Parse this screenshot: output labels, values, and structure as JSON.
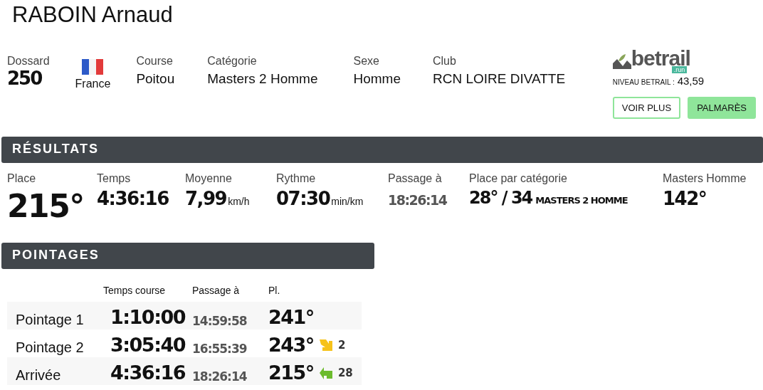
{
  "athlete": {
    "name": "RABOIN Arnaud"
  },
  "info": {
    "bib_label": "Dossard",
    "bib": "250",
    "country": "France",
    "fields": [
      {
        "label": "Course",
        "value": "Poitou"
      },
      {
        "label": "Catégorie",
        "value": "Masters 2 Homme"
      },
      {
        "label": "Sexe",
        "value": "Homme"
      },
      {
        "label": "Club",
        "value": "RCN LOIRE DIVATTE"
      }
    ]
  },
  "betrail": {
    "logo": "betrail",
    "logo_badge": ".run",
    "level_label": "NIVEAU BETRAIL :",
    "level": "43,59",
    "buttons": [
      {
        "label": "VOIR PLUS",
        "kind": "outline"
      },
      {
        "label": "PALMARÈS",
        "kind": "filled"
      }
    ]
  },
  "results": {
    "title": "RÉSULTATS",
    "stats": [
      {
        "label": "Place",
        "value": "215°",
        "kind": "big"
      },
      {
        "label": "Temps",
        "value": "4:36:16",
        "kind": "main"
      },
      {
        "label": "Moyenne",
        "value": "7,99",
        "unit": "km/h",
        "kind": "main"
      },
      {
        "label": "Rythme",
        "value": "07:30",
        "unit": "min/km",
        "kind": "main"
      },
      {
        "label": "Passage à",
        "value": "18:26:14",
        "kind": "muted"
      },
      {
        "label": "Place par catégorie",
        "value": "28° / 34",
        "unit": "MASTERS 2 HOMME",
        "kind": "category"
      },
      {
        "label": "Masters Homme",
        "value": "142°",
        "kind": "main"
      }
    ]
  },
  "checkpoints": {
    "title": "POINTAGES",
    "columns": [
      "Temps course",
      "Passage à",
      "Pl."
    ],
    "rows": [
      {
        "name": "Pointage 1",
        "time": "1:10:00",
        "passage": "14:59:58",
        "place": "241°"
      },
      {
        "name": "Pointage 2",
        "time": "3:05:40",
        "passage": "16:55:39",
        "place": "243°",
        "improved": false,
        "delta": "2"
      },
      {
        "name": "Arrivée",
        "time": "4:36:16",
        "passage": "18:26:14",
        "place": "215°",
        "improved": true,
        "delta": "28"
      }
    ]
  }
}
